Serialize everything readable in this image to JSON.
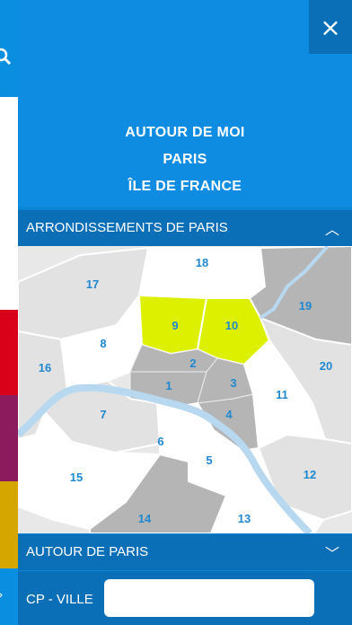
{
  "menu": {
    "items": [
      "AUTOUR DE MOI",
      "PARIS",
      "ÎLE DE FRANCE"
    ],
    "close_icon": "×"
  },
  "sections": {
    "arrondissements_title": "ARRONDISSEMENTS DE PARIS",
    "autour_title": "AUTOUR DE PARIS"
  },
  "search": {
    "label": "CP - VILLE",
    "placeholder": ""
  },
  "map": {
    "arrondissements": [
      "1",
      "2",
      "3",
      "4",
      "5",
      "6",
      "7",
      "8",
      "9",
      "10",
      "11",
      "12",
      "13",
      "14",
      "15",
      "16",
      "17",
      "18",
      "19",
      "20"
    ],
    "highlighted": [
      "9",
      "10"
    ]
  },
  "colors": {
    "background": "#0b86d6",
    "section_bar": "#0b6fb8",
    "highlight": "#ddf000",
    "label": "#1f88cf"
  }
}
